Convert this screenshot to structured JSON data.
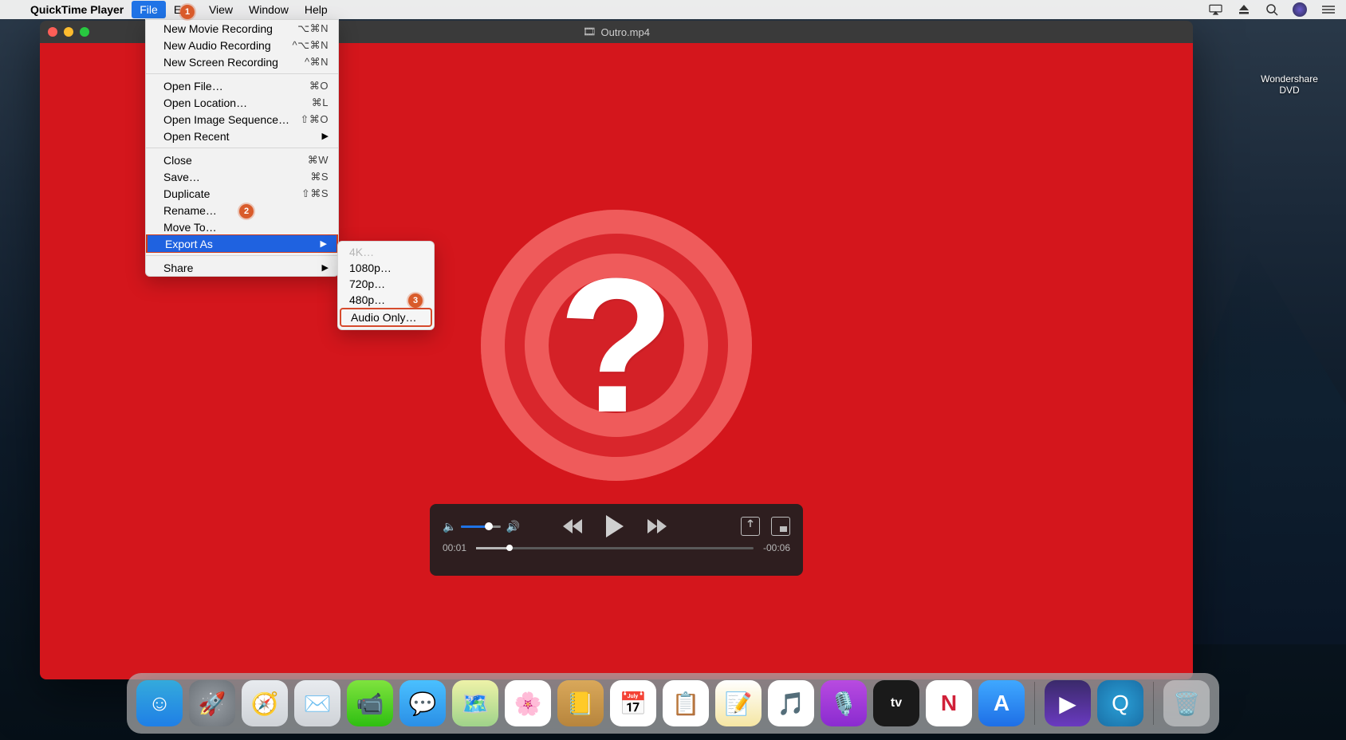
{
  "menubar": {
    "app_name": "QuickTime Player",
    "items": [
      "File",
      "Edit",
      "View",
      "Window",
      "Help"
    ]
  },
  "status_icons": [
    "airplay",
    "eject",
    "search",
    "siri",
    "menu"
  ],
  "file_menu": {
    "sections": [
      [
        {
          "label": "New Movie Recording",
          "shortcut": "⌥⌘N"
        },
        {
          "label": "New Audio Recording",
          "shortcut": "^⌥⌘N"
        },
        {
          "label": "New Screen Recording",
          "shortcut": "^⌘N"
        }
      ],
      [
        {
          "label": "Open File…",
          "shortcut": "⌘O"
        },
        {
          "label": "Open Location…",
          "shortcut": "⌘L"
        },
        {
          "label": "Open Image Sequence…",
          "shortcut": "⇧⌘O"
        },
        {
          "label": "Open Recent",
          "submenu": true
        }
      ],
      [
        {
          "label": "Close",
          "shortcut": "⌘W"
        },
        {
          "label": "Save…",
          "shortcut": "⌘S"
        },
        {
          "label": "Duplicate",
          "shortcut": "⇧⌘S"
        },
        {
          "label": "Rename…"
        },
        {
          "label": "Move To…"
        },
        {
          "label": "Export As",
          "submenu": true,
          "highlight": true
        }
      ],
      [
        {
          "label": "Share",
          "submenu": true
        }
      ]
    ]
  },
  "submenu": {
    "items": [
      {
        "label": "4K…",
        "disabled": true
      },
      {
        "label": "1080p…"
      },
      {
        "label": "720p…"
      },
      {
        "label": "480p…"
      },
      {
        "label": "Audio Only…",
        "highlight": true
      }
    ]
  },
  "callouts": {
    "one": "1",
    "two": "2",
    "three": "3"
  },
  "window": {
    "title": "Outro.mp4"
  },
  "player": {
    "elapsed": "00:01",
    "remaining": "-00:06"
  },
  "desktop": {
    "dvd_label": "Wondershare DVD"
  },
  "dock": {
    "apps": [
      {
        "name": "finder",
        "bg": "linear-gradient(#34aadc,#1f7fe6)",
        "glyph": "☺"
      },
      {
        "name": "launchpad",
        "bg": "radial-gradient(circle,#9aa0a6,#6b7177)",
        "glyph": "🚀"
      },
      {
        "name": "safari",
        "bg": "linear-gradient(#e8ebef,#cfd3d8)",
        "glyph": "🧭"
      },
      {
        "name": "mail",
        "bg": "linear-gradient(#e8ebef,#cfd3d8)",
        "glyph": "✉️"
      },
      {
        "name": "facetime",
        "bg": "linear-gradient(#7fe33e,#2fbf12)",
        "glyph": "📹"
      },
      {
        "name": "messages",
        "bg": "linear-gradient(#4ac0ff,#2a8fe6)",
        "glyph": "💬"
      },
      {
        "name": "maps",
        "bg": "linear-gradient(#eef2a8,#9fd38a)",
        "glyph": "🗺️"
      },
      {
        "name": "photos",
        "bg": "#fff",
        "glyph": "🌸"
      },
      {
        "name": "contacts",
        "bg": "linear-gradient(#d9a85a,#b7853d)",
        "glyph": "📒"
      },
      {
        "name": "calendar",
        "bg": "#fff",
        "glyph": "📅"
      },
      {
        "name": "reminders",
        "bg": "#fff",
        "glyph": "📋"
      },
      {
        "name": "notes",
        "bg": "linear-gradient(#fff,#f5e6a3)",
        "glyph": "📝"
      },
      {
        "name": "music",
        "bg": "#fff",
        "glyph": "🎵"
      },
      {
        "name": "podcasts",
        "bg": "linear-gradient(#b84be0,#8a2bd0)",
        "glyph": "🎙️"
      },
      {
        "name": "tv",
        "bg": "#1a1a1a",
        "glyph": "tv"
      },
      {
        "name": "news",
        "bg": "#fff",
        "glyph": "N"
      },
      {
        "name": "appstore",
        "bg": "linear-gradient(#3fa8ff,#1e6fe6)",
        "glyph": "A"
      }
    ],
    "right": [
      {
        "name": "uniconverter",
        "bg": "linear-gradient(#3a2a6a,#6a3ac0)",
        "glyph": "▶"
      },
      {
        "name": "quicktime",
        "bg": "radial-gradient(circle,#2a9fd6,#1a6fa6)",
        "glyph": "Q"
      }
    ],
    "trash": {
      "name": "trash",
      "glyph": "🗑️"
    }
  }
}
